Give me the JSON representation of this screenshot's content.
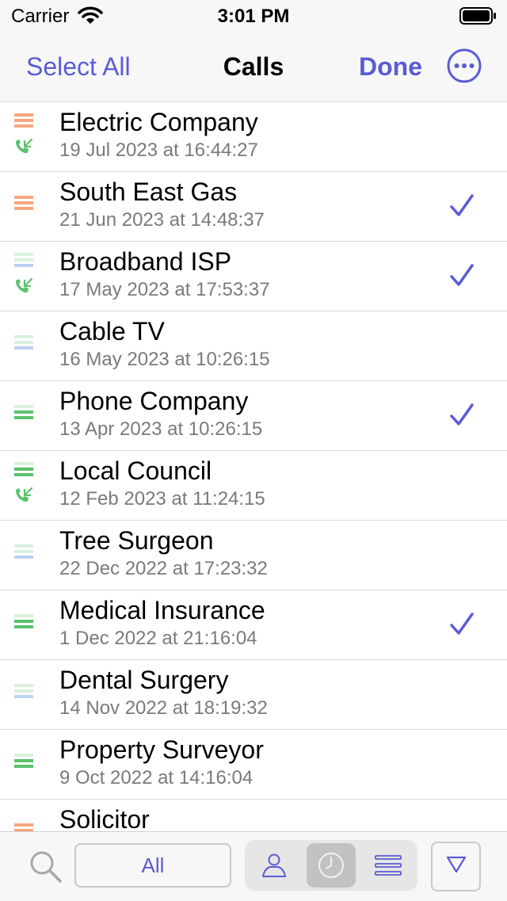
{
  "status_bar": {
    "carrier": "Carrier",
    "time": "3:01 PM"
  },
  "nav": {
    "select_all": "Select All",
    "title": "Calls",
    "done": "Done",
    "more_icon": "ellipsis-circle-icon"
  },
  "colors": {
    "accent": "#5b5bd6",
    "orange": "#f5a77e",
    "green": "#5ac26b",
    "light_green": "#d9f0dd",
    "light_blue": "#bcd0f5"
  },
  "calls": [
    {
      "name": "Electric Company",
      "date": "19 Jul 2023 at 16:44:27",
      "bars": [
        "orange",
        "orange",
        "orange"
      ],
      "incoming": true,
      "checked": false
    },
    {
      "name": "South East Gas",
      "date": "21 Jun 2023 at 14:48:37",
      "bars": [
        "orange",
        "orange",
        "orange"
      ],
      "incoming": false,
      "checked": true
    },
    {
      "name": "Broadband ISP",
      "date": "17 May 2023 at 17:53:37",
      "bars": [
        "light_green",
        "light_green",
        "light_blue"
      ],
      "incoming": true,
      "checked": true
    },
    {
      "name": "Cable TV",
      "date": "16 May 2023 at 10:26:15",
      "bars": [
        "light_green",
        "light_green",
        "light_blue"
      ],
      "incoming": false,
      "checked": false
    },
    {
      "name": "Phone Company",
      "date": "13 Apr 2023 at 10:26:15",
      "bars": [
        "light_green",
        "green",
        "green"
      ],
      "incoming": false,
      "checked": true
    },
    {
      "name": "Local Council",
      "date": "12 Feb 2023 at 11:24:15",
      "bars": [
        "light_green",
        "green",
        "green"
      ],
      "incoming": true,
      "checked": false
    },
    {
      "name": "Tree Surgeon",
      "date": "22 Dec 2022 at 17:23:32",
      "bars": [
        "light_green",
        "light_green",
        "light_blue"
      ],
      "incoming": false,
      "checked": false
    },
    {
      "name": "Medical Insurance",
      "date": "1 Dec 2022 at 21:16:04",
      "bars": [
        "light_green",
        "green",
        "green"
      ],
      "incoming": false,
      "checked": true
    },
    {
      "name": "Dental Surgery",
      "date": "14 Nov 2022 at 18:19:32",
      "bars": [
        "light_green",
        "light_green",
        "light_blue"
      ],
      "incoming": false,
      "checked": false
    },
    {
      "name": "Property Surveyor",
      "date": "9 Oct 2022 at 14:16:04",
      "bars": [
        "light_green",
        "green",
        "green"
      ],
      "incoming": false,
      "checked": false
    },
    {
      "name": "Solicitor",
      "date": "",
      "bars": [
        "orange",
        "orange",
        "orange"
      ],
      "incoming": false,
      "checked": false
    }
  ],
  "toolbar": {
    "search_icon": "magnifier-icon",
    "filter_label": "All",
    "segments": [
      {
        "icon": "person-icon",
        "active": false
      },
      {
        "icon": "clock-icon",
        "active": true
      },
      {
        "icon": "list-lines-icon",
        "active": false
      }
    ],
    "sort_icon": "triangle-down-icon"
  }
}
